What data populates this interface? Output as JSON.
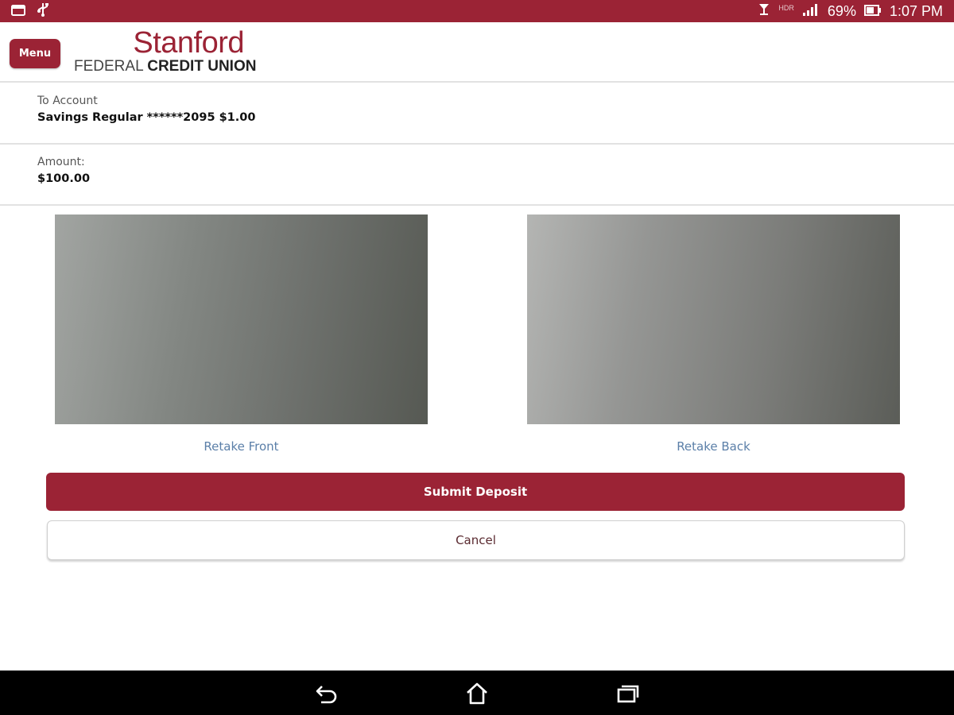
{
  "status_bar": {
    "signal_label": "HDR",
    "battery": "69%",
    "time": "1:07 PM"
  },
  "header": {
    "menu_label": "Menu",
    "logo": {
      "top": "Stanford",
      "bottom_light": "FEDERAL",
      "bottom_bold": "CREDIT UNION"
    }
  },
  "to_account": {
    "label": "To Account",
    "value": "Savings Regular ******2095 $1.00"
  },
  "amount": {
    "label": "Amount:",
    "value": "$100.00"
  },
  "checks": {
    "retake_front": "Retake Front",
    "retake_back": "Retake Back"
  },
  "actions": {
    "submit": "Submit Deposit",
    "cancel": "Cancel"
  },
  "colors": {
    "brand": "#9b2335",
    "link": "#5b7fa8"
  },
  "icons": {
    "status_left": [
      "gallery-icon",
      "usb-icon"
    ],
    "status_right": [
      "alarm-icon",
      "signal-icon",
      "battery-icon"
    ],
    "nav": [
      "back-icon",
      "home-icon",
      "recents-icon"
    ]
  }
}
